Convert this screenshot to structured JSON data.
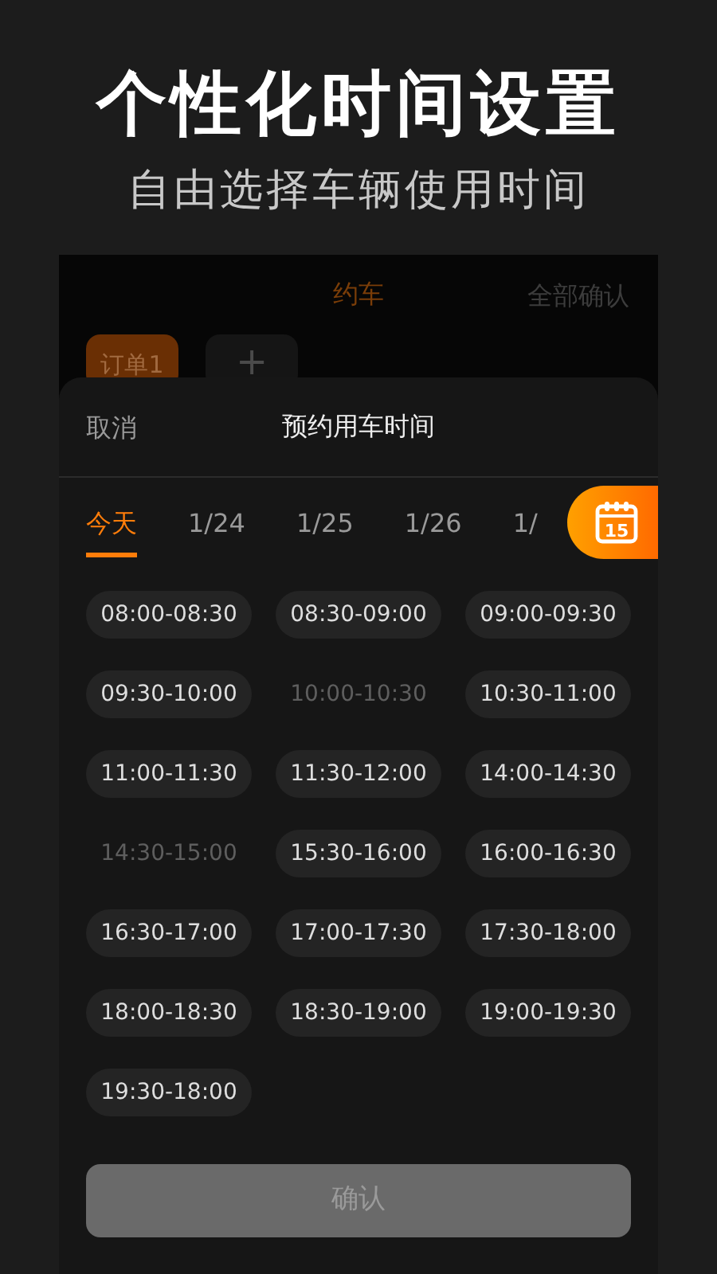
{
  "headline": "个性化时间设置",
  "subheadline": "自由选择车辆使用时间",
  "app_header": {
    "title": "约车",
    "action": "全部确认"
  },
  "orders": [
    {
      "label": "订单1",
      "selected": true
    }
  ],
  "add_order": "+",
  "sheet": {
    "cancel": "取消",
    "title": "预约用车时间",
    "date_tabs": [
      {
        "label": "今天",
        "selected": true
      },
      {
        "label": "1/24",
        "selected": false
      },
      {
        "label": "1/25",
        "selected": false
      },
      {
        "label": "1/26",
        "selected": false
      },
      {
        "label": "1/",
        "selected": false
      }
    ],
    "calendar_badge": "15",
    "slots": [
      {
        "label": "08:00-08:30",
        "disabled": false
      },
      {
        "label": "08:30-09:00",
        "disabled": false
      },
      {
        "label": "09:00-09:30",
        "disabled": false
      },
      {
        "label": "09:30-10:00",
        "disabled": false
      },
      {
        "label": "10:00-10:30",
        "disabled": true
      },
      {
        "label": "10:30-11:00",
        "disabled": false
      },
      {
        "label": "11:00-11:30",
        "disabled": false
      },
      {
        "label": "11:30-12:00",
        "disabled": false
      },
      {
        "label": "14:00-14:30",
        "disabled": false
      },
      {
        "label": "14:30-15:00",
        "disabled": true
      },
      {
        "label": "15:30-16:00",
        "disabled": false
      },
      {
        "label": "16:00-16:30",
        "disabled": false
      },
      {
        "label": "16:30-17:00",
        "disabled": false
      },
      {
        "label": "17:00-17:30",
        "disabled": false
      },
      {
        "label": "17:30-18:00",
        "disabled": false
      },
      {
        "label": "18:00-18:30",
        "disabled": false
      },
      {
        "label": "18:30-19:00",
        "disabled": false
      },
      {
        "label": "19:00-19:30",
        "disabled": false
      },
      {
        "label": "19:30-18:00",
        "disabled": false
      }
    ],
    "confirm": {
      "label": "确认",
      "disabled": true
    }
  }
}
